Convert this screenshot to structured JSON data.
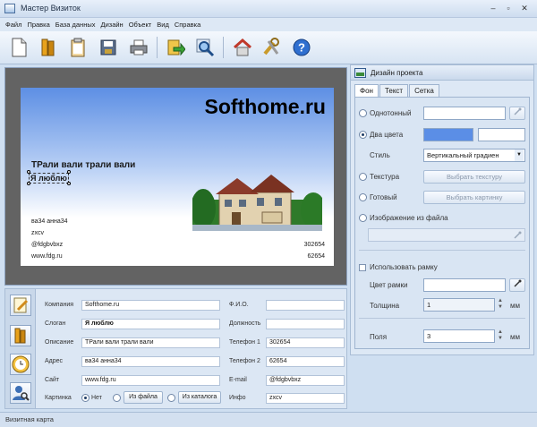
{
  "window": {
    "title": "Мастер Визиток",
    "minimize": "–",
    "restore": "▫",
    "close": "✕"
  },
  "menu": [
    "Файл",
    "Правка",
    "База данных",
    "Дизайн",
    "Объект",
    "Вид",
    "Справка"
  ],
  "toolbar": [
    {
      "icon": "new-document-icon"
    },
    {
      "icon": "open-folder-icon"
    },
    {
      "icon": "clipboard-icon"
    },
    {
      "icon": "save-disk-icon"
    },
    {
      "icon": "print-icon"
    },
    {
      "icon": "export-arrow-icon"
    },
    {
      "icon": "zoom-magnifier-icon"
    },
    {
      "icon": "home-icon"
    },
    {
      "icon": "tools-icon"
    },
    {
      "icon": "help-icon"
    }
  ],
  "card": {
    "name": "Softhome.ru",
    "slogan1": "ТРали вали трали вали",
    "slogan2": "Я люблю",
    "left_lines": [
      "ва34 анна34",
      "zxcv",
      "@fdgbvbxz",
      "www.fdg.ru"
    ],
    "right_lines": [
      "302654",
      "62654"
    ]
  },
  "form": {
    "labels": {
      "company": "Компания",
      "slogan": "Слоган",
      "description": "Описание",
      "address": "Адрес",
      "site": "Сайт",
      "picture": "Картинка",
      "fio": "Ф.И.О.",
      "position": "Должность",
      "phone1": "Телефон 1",
      "phone2": "Телефон 2",
      "email": "E-mail",
      "info": "Инфо"
    },
    "values": {
      "company": "Softhome.ru",
      "slogan": "Я люблю",
      "description": "ТРали вали трали вали",
      "address": "ва34 анна34",
      "site": "www.fdg.ru",
      "fio": "",
      "position": "",
      "phone1": "302654",
      "phone2": "62654",
      "email": "@fdgbvbxz",
      "info": "zxcv"
    },
    "picture_options": {
      "none": "Нет",
      "from_file": "Из файла",
      "from_catalog": "Из каталога"
    }
  },
  "panel": {
    "title": "Дизайн проекта",
    "tabs": [
      "Фон",
      "Текст",
      "Сетка"
    ],
    "active_tab": "Фон",
    "one_color": "Однотонный",
    "two_colors": "Два цвета",
    "style_label": "Стиль",
    "style_value": "Вертикальный градиен",
    "texture": "Текстура",
    "choose_texture": "Выбрать текстуру",
    "ready": "Готовый",
    "choose_picture": "Выбрать картинку",
    "image_from_file": "Изображение из файла",
    "use_frame": "Использовать рамку",
    "frame_color": "Цвет рамки",
    "thickness": "Толщина",
    "thickness_value": "1",
    "unit": "мм",
    "margins": "Поля",
    "margins_value": "3",
    "colors": {
      "color1": "#5b8ee6",
      "color2": "#ffffff"
    }
  },
  "status": "Визитная карта"
}
